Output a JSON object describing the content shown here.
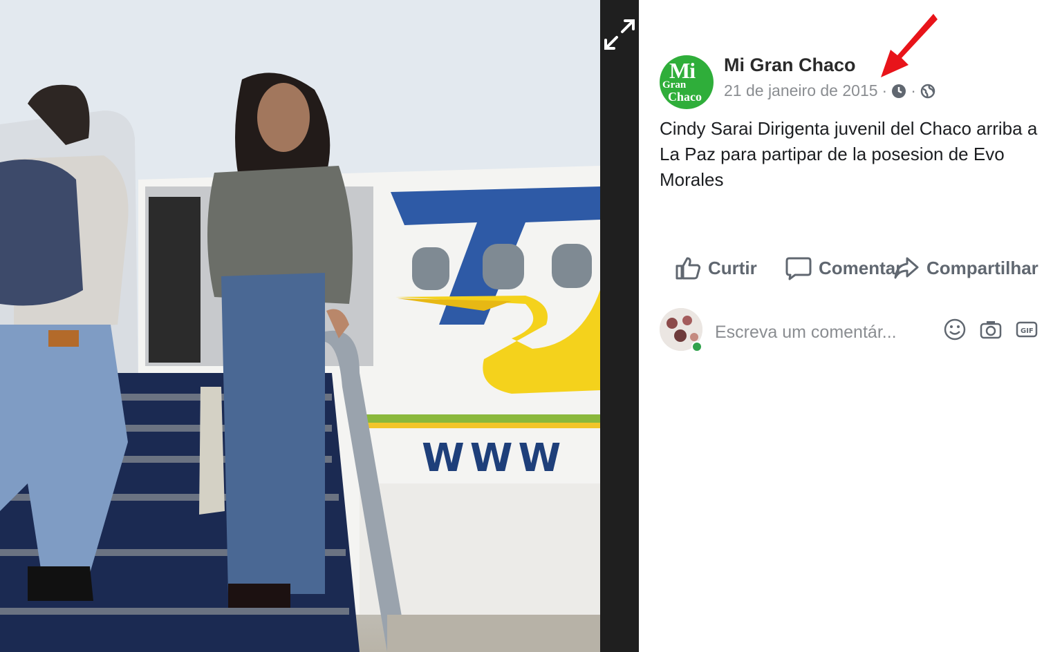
{
  "post": {
    "page_name": "Mi Gran Chaco",
    "date": "21 de janeiro de 2015",
    "separator": "·",
    "text_lines": [
      "Cindy Sarai Dirigenta juvenil del Chaco arriba a",
      "La Paz para partipar de la posesion de Evo",
      "Morales"
    ],
    "avatar_logo": {
      "line1": "Mi",
      "line2": "Gran",
      "line3": "Chaco"
    }
  },
  "actions": {
    "like_label": "Curtir",
    "comment_label": "Comentar",
    "share_label": "Compartilhar"
  },
  "comment_box": {
    "placeholder": "Escreva um comentár..."
  },
  "photo": {
    "aircraft_text": "WWW",
    "aircraft_logo_letter": "T"
  },
  "icons": {
    "expand": "expand-arrows-icon",
    "clock": "clock-icon",
    "globe": "globe-icon",
    "like": "thumbs-up-icon",
    "comment": "speech-bubble-icon",
    "share": "share-arrow-icon",
    "emoji": "smiley-icon",
    "camera": "camera-icon",
    "gif": "gif-icon",
    "annotation": "red-arrow-icon"
  },
  "colors": {
    "brand_green": "#2fae3a",
    "annotation_red": "#e8141a",
    "aircraft_blue": "#2e5aa6",
    "aircraft_yellow": "#f4d21c"
  }
}
